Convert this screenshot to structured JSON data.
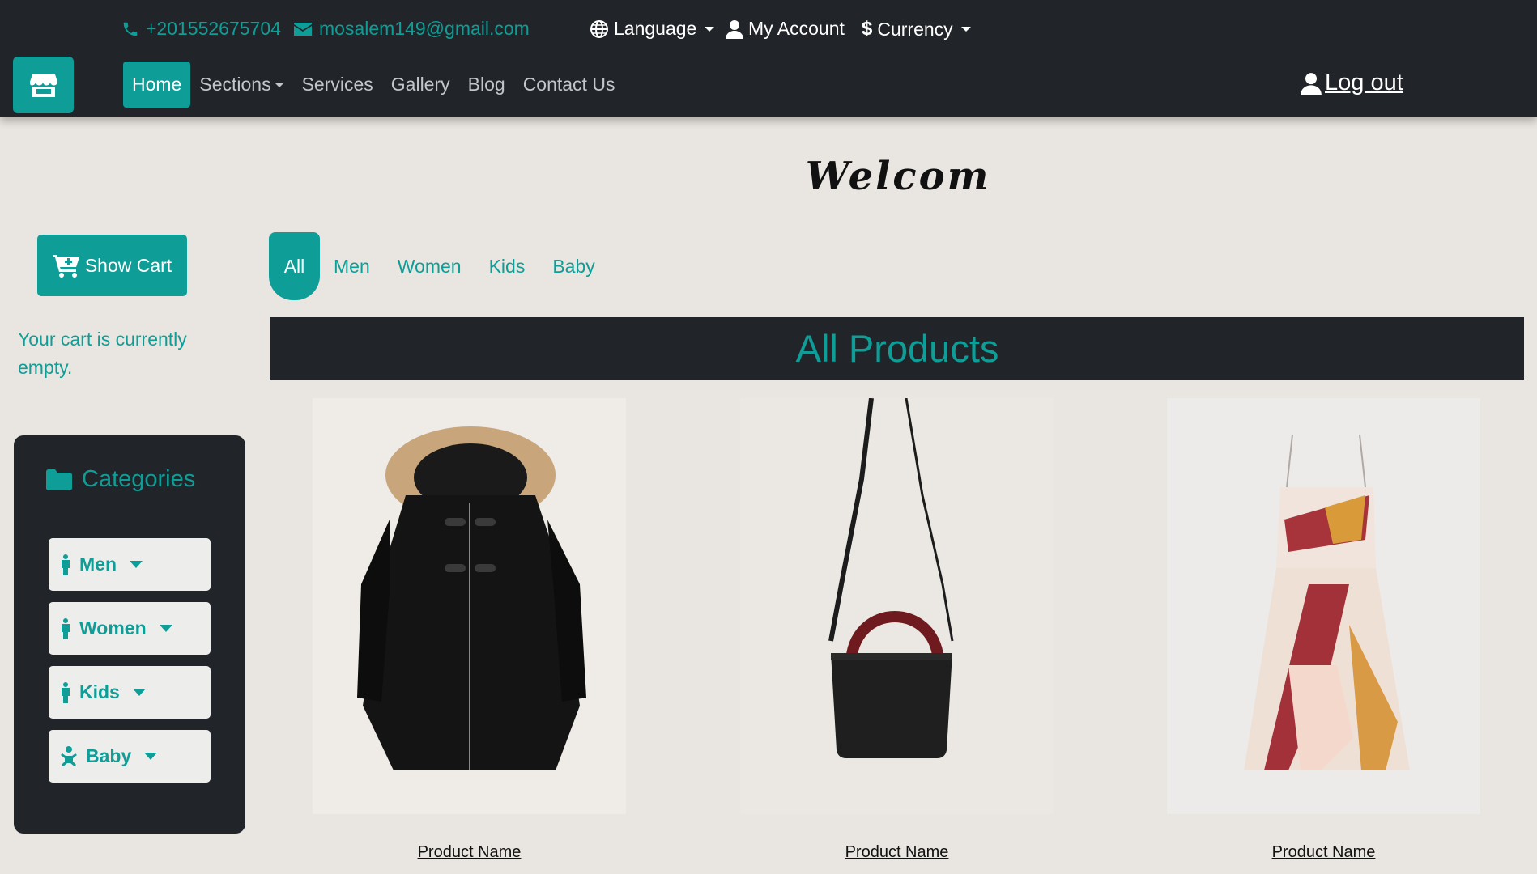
{
  "topbar": {
    "phone": "+201552675704",
    "email": "mosalem149@gmail.com",
    "language": "Language",
    "account": "My Account",
    "currency": "Currency"
  },
  "nav": {
    "items": [
      "Home",
      "Sections",
      "Services",
      "Gallery",
      "Blog",
      "Contact Us"
    ],
    "logout": "Log out"
  },
  "welcome": "Welcom",
  "cart": {
    "button": "Show Cart",
    "empty": "Your cart is currently empty."
  },
  "categories": {
    "title": "Categories",
    "items": [
      "Men",
      "Women",
      "Kids",
      "Baby"
    ]
  },
  "filters": [
    "All",
    "Men",
    "Women",
    "Kids",
    "Baby"
  ],
  "products": {
    "heading": "All Products",
    "items": [
      {
        "name": "Product Name",
        "image": "black-hooded-coat"
      },
      {
        "name": "Product Name",
        "image": "black-handbag"
      },
      {
        "name": "Product Name",
        "image": "patterned-dress"
      }
    ]
  },
  "colors": {
    "accent": "#0e9e97",
    "dark": "#212529",
    "background": "#e9e6e1"
  }
}
